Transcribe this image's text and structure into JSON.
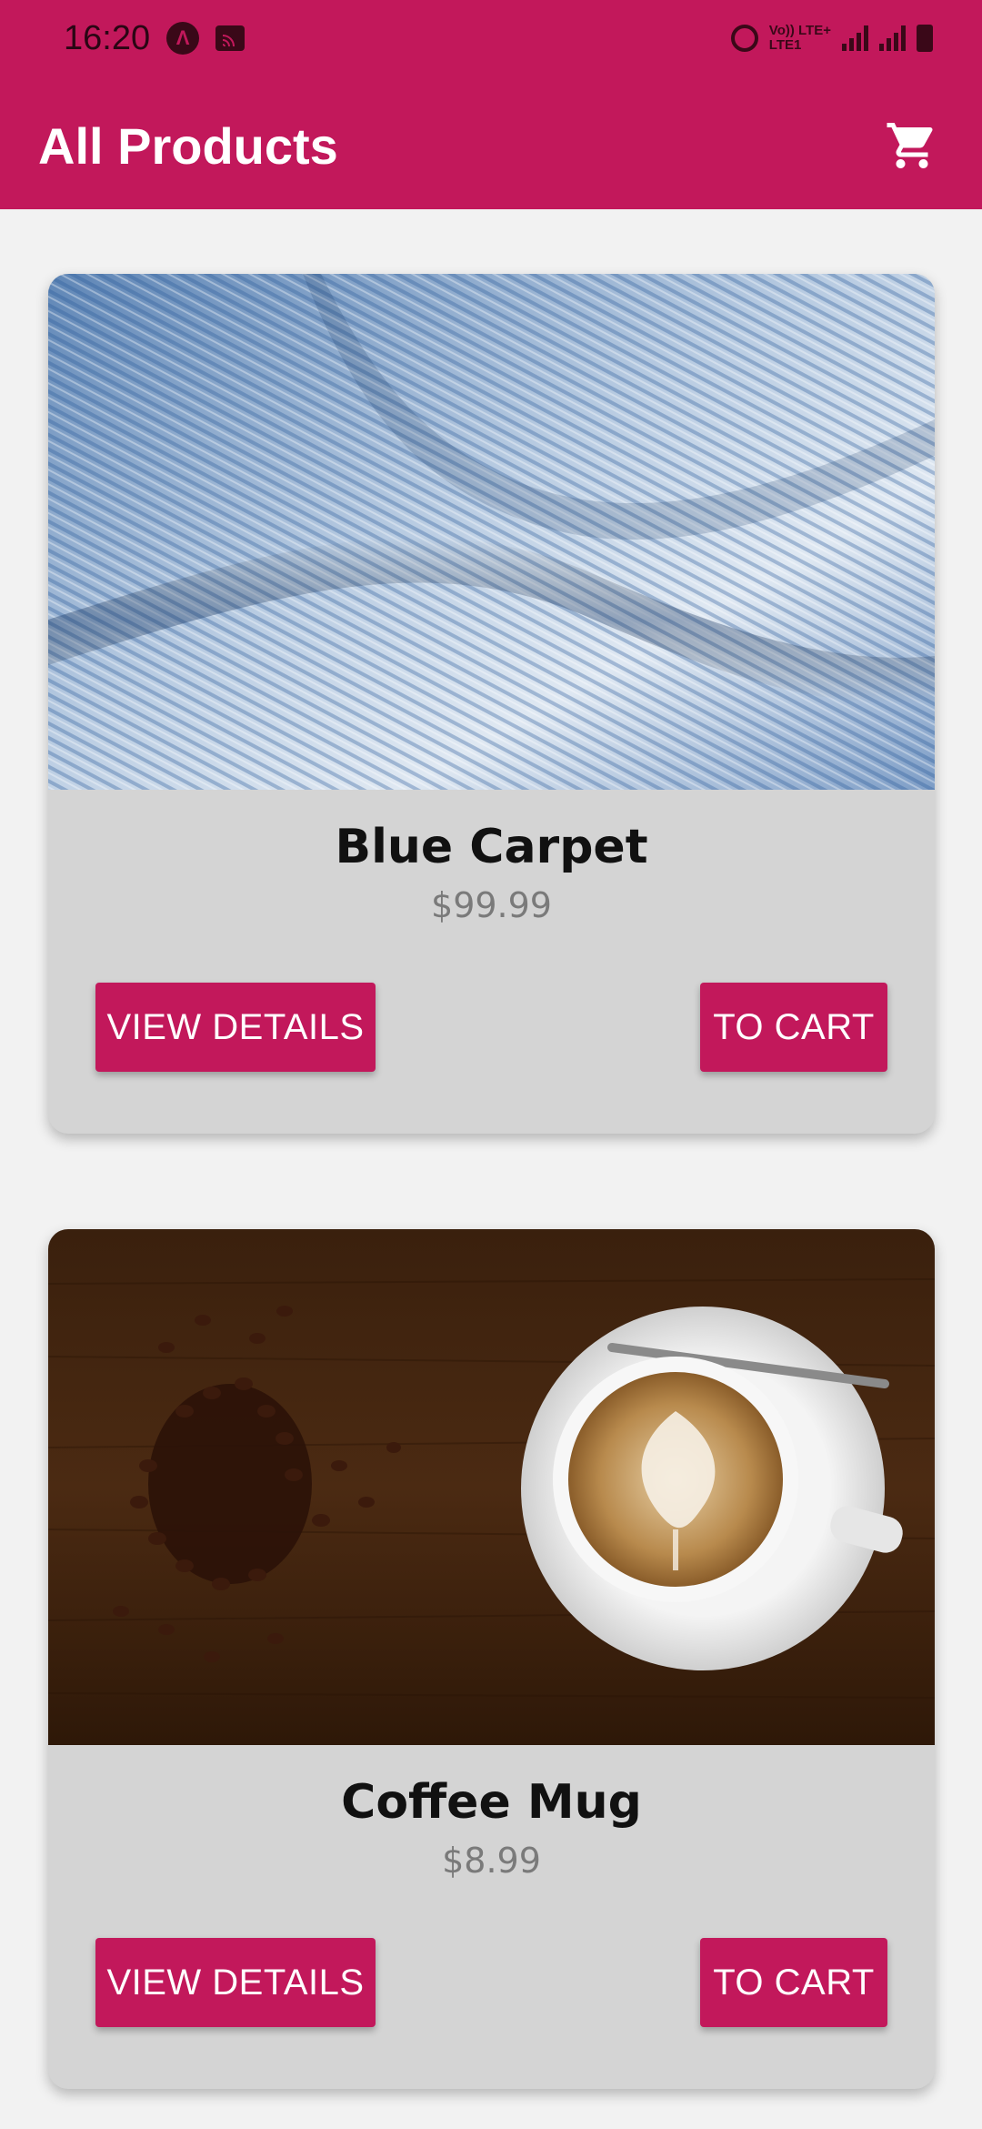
{
  "status_bar": {
    "time": "16:20",
    "network_top": "Vo)) LTE+",
    "network_bottom": "LTE1"
  },
  "app_bar": {
    "title": "All Products",
    "cart_icon": "shopping-cart-icon",
    "color": "#c2185b"
  },
  "products": [
    {
      "name": "Blue Carpet",
      "price": "$99.99",
      "image": "blue-knit-fabric",
      "details_label": "VIEW DETAILS",
      "cart_label": "TO CART"
    },
    {
      "name": "Coffee Mug",
      "price": "$8.99",
      "image": "coffee-cup-and-beans",
      "details_label": "VIEW DETAILS",
      "cart_label": "TO CART"
    }
  ]
}
